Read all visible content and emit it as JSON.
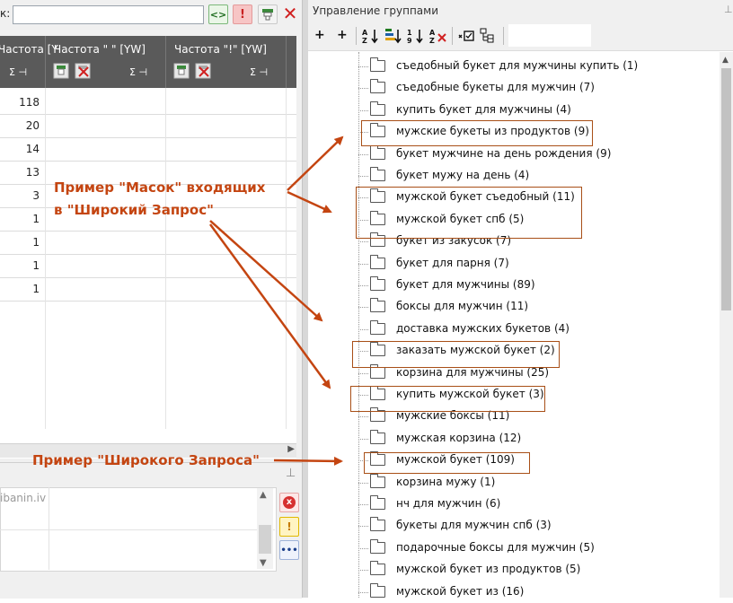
{
  "left": {
    "filter_label": "к:",
    "filter_value": "",
    "toolbar": {
      "arrows_label": "<>",
      "exclaim_label": "!",
      "close_label": "✕"
    },
    "grid": {
      "columns": [
        "Частота [Y",
        "Частота \" \" [YW]",
        "Частота \"!\" [YW]"
      ],
      "column_icons": [
        "Σ ⊣",
        "Σ ⊣",
        "Σ ⊣"
      ],
      "rows": [
        "118",
        "20",
        "14",
        "13",
        "3",
        "1",
        "1",
        "1",
        "1"
      ]
    },
    "log_text": "ibanin.iv",
    "side_buttons": {
      "error": "x",
      "warning": "!",
      "info": "•••"
    }
  },
  "right": {
    "title": "Управление группами",
    "tree": [
      "съедобный букет для мужчины купить (1)",
      "съедобные букеты для мужчин (7)",
      "купить букет для мужчины (4)",
      "мужские букеты из продуктов (9)",
      "букет мужчине на день рождения (9)",
      "букет мужу на день (4)",
      "мужской букет съедобный (11)",
      "мужской букет спб (5)",
      "букет из закусок (7)",
      "букет для парня (7)",
      "букет для мужчины (89)",
      "боксы для мужчин (11)",
      "доставка мужских букетов (4)",
      "заказать мужской букет (2)",
      "корзина для мужчины (25)",
      "купить мужской букет (3)",
      "мужские боксы (11)",
      "мужская корзина (12)",
      "мужской букет (109)",
      "корзина мужу (1)",
      "нч для мужчин (6)",
      "букеты для мужчин спб (3)",
      "подарочные боксы для мужчин (5)",
      "мужской букет из продуктов (5)",
      "мужской букет из (16)"
    ]
  },
  "annotations": {
    "masks_line1": "Пример \"Масок\" входящих",
    "masks_line2": "в \"Широкий Запрос\"",
    "broad": "Пример \"Широкого Запроса\""
  },
  "colors": {
    "annotation": "#c44511",
    "box": "#a84f17",
    "header": "#5a5a5a"
  }
}
